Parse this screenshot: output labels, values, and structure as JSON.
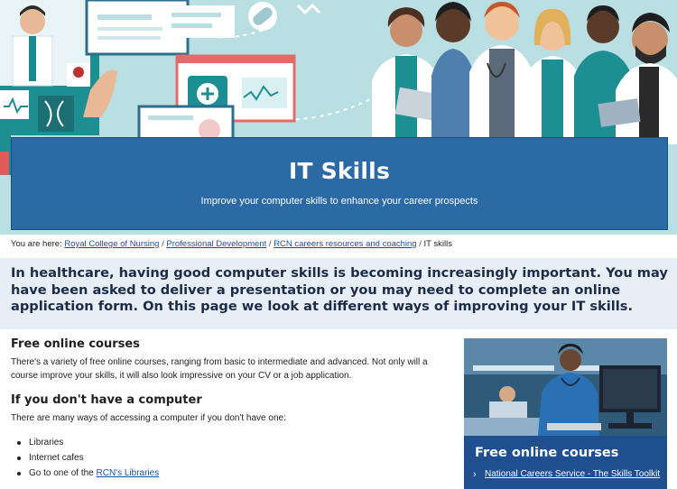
{
  "hero": {
    "title": "IT Skills",
    "subtitle": "Improve your computer skills to enhance your career prospects"
  },
  "breadcrumb": {
    "prefix": "You are here:",
    "items": [
      "Royal College of Nursing",
      "Professional Development",
      "RCN careers resources and coaching"
    ],
    "current": "IT skills"
  },
  "intro": "In healthcare, having good computer skills is becoming increasingly important. You may have been asked to deliver a presentation or you may need to complete an online application form. On this page we look at different ways of improving your IT skills.",
  "sections": {
    "online_courses": {
      "heading": "Free online courses",
      "body": "There's a variety of free online courses, ranging from basic to intermediate and advanced. Not only will a course improve your skills, it will also look impressive on your CV or a job application."
    },
    "no_computer": {
      "heading": "If you don't have a computer",
      "body": "There are many ways of accessing a computer if you don't have one:",
      "list": [
        "Libraries",
        "Internet cafes"
      ],
      "list_last_prefix": "Go to one of the",
      "list_last_link": "RCN's Libraries"
    }
  },
  "side_card": {
    "heading": "Free online courses",
    "link": "National Careers Service - The Skills Toolkit"
  },
  "colors": {
    "title_card": "#2c6aa6",
    "intro_band": "#e8eef6",
    "link": "#1d4f9a",
    "side_card": "#1f4f8f"
  }
}
